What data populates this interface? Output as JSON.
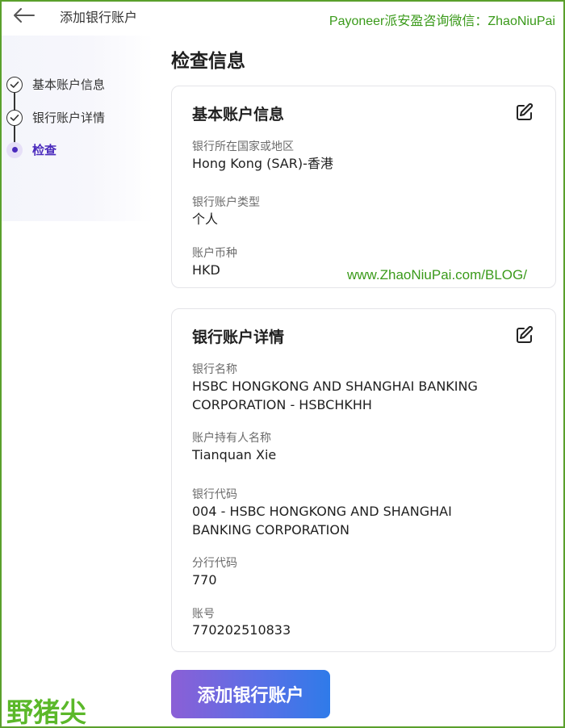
{
  "header": {
    "title": "添加银行账户",
    "back_icon": "arrow-left-icon"
  },
  "watermarks": {
    "top": "Payoneer派安盈咨询微信：ZhaoNiuPai",
    "mid": "www.ZhaoNiuPai.com/BLOG/",
    "bottom": "野猪尖"
  },
  "steps": [
    {
      "label": "基本账户信息",
      "state": "done"
    },
    {
      "label": "银行账户详情",
      "state": "done"
    },
    {
      "label": "检查",
      "state": "active"
    }
  ],
  "main": {
    "title": "检查信息",
    "cards": [
      {
        "title": "基本账户信息",
        "fields": [
          {
            "label": "银行所在国家或地区",
            "value": "Hong Kong (SAR)-香港"
          },
          {
            "label": "银行账户类型",
            "value": "个人"
          },
          {
            "label": "账户币种",
            "value": "HKD"
          }
        ]
      },
      {
        "title": "银行账户详情",
        "fields": [
          {
            "label": "银行名称",
            "value": "HSBC HONGKONG AND SHANGHAI BANKING CORPORATION - HSBCHKHH"
          },
          {
            "label": "账户持有人名称",
            "value": "Tianquan Xie"
          },
          {
            "label": "银行代码",
            "value": "004 - HSBC HONGKONG AND SHANGHAI BANKING CORPORATION"
          },
          {
            "label": "分行代码",
            "value": "770"
          },
          {
            "label": "账号",
            "value": "770202510833"
          }
        ]
      }
    ],
    "submit_label": "添加银行账户"
  },
  "colors": {
    "accent": "#4b2bbd",
    "watermark_green": "#3a9a1a",
    "button_gradient_start": "#8b5fd6",
    "button_gradient_end": "#2f7be9"
  }
}
